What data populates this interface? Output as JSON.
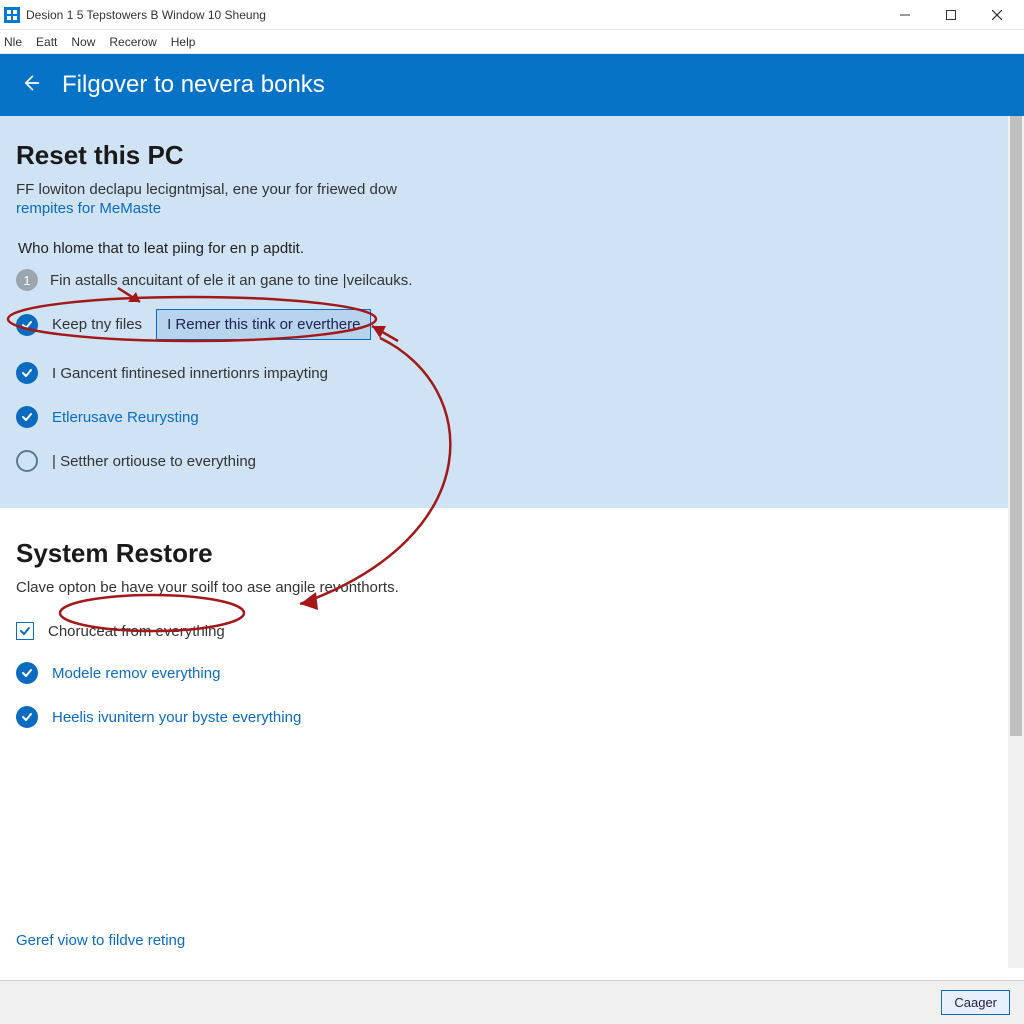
{
  "titlebar": {
    "title": "Desion 1 5 Tepstowers B Window 10 Sheung"
  },
  "menubar": {
    "items": [
      "Nle",
      "Eatt",
      "Now",
      "Recerow",
      "Help"
    ]
  },
  "header": {
    "title": "Filgover to nevera bonks"
  },
  "reset": {
    "heading": "Reset this PC",
    "desc": "FF lowiton declapu lecigntmjsal, ene your for friewed dow",
    "link": "rempites for MeMaste",
    "prompt": "Who hlome that to leat piing for en p apdtit.",
    "step1_num": "1",
    "step1_text": "Fin astalls ancuitant of ele it an gane to tine |veilcauks.",
    "opt1_label": "Keep tny files",
    "opt1_highlight": "I Remer this tink or everthere",
    "opt2_label": "I Gancent fintinesed innertionrs impayting",
    "opt3_label": "Etlerusave Reurysting",
    "opt4_label": "| Setther ortiouse to everything"
  },
  "restore": {
    "heading": "System Restore",
    "desc": "Clave opton be have your soilf too ase angile revonthorts.",
    "chk1_label": "Choruceat from everything",
    "opt2_label": "Modele remov everything",
    "opt3_label": "Heelis ivunitern your byste everything"
  },
  "footer_link": "Geref viow to fildve reting",
  "bottom": {
    "button": "Caager"
  }
}
